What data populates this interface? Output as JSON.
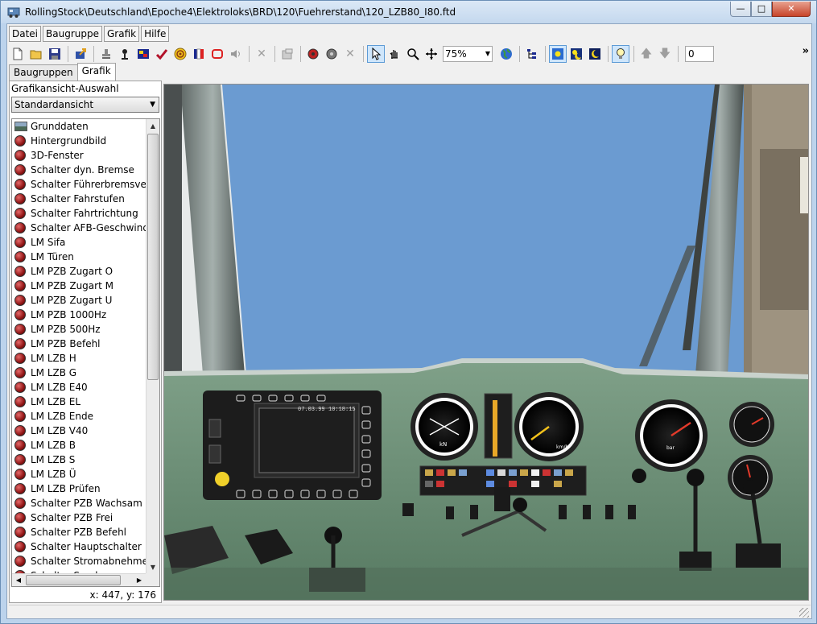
{
  "window": {
    "title": "RollingStock\\Deutschland\\Epoche4\\Elektroloks\\BRD\\120\\Fuehrerstand\\120_LZB80_I80.ftd",
    "controls": [
      "minimize",
      "maximize",
      "close"
    ]
  },
  "menu": [
    {
      "label": "Datei",
      "accel": "D"
    },
    {
      "label": "Baugruppe",
      "accel": "B"
    },
    {
      "label": "Grafik",
      "accel": "G"
    },
    {
      "label": "Hilfe",
      "accel": "H"
    }
  ],
  "toolbar": {
    "zoom": "75%",
    "number_value": "0",
    "overflow": "»",
    "icons": [
      "new-file-icon",
      "open-folder-icon",
      "save-icon",
      "export-icon",
      "stamp-icon",
      "pin-icon",
      "color-icon",
      "check-icon",
      "spiral-icon",
      "flag-icon",
      "frame-icon",
      "speaker-icon",
      "delete-icon",
      "properties-icon",
      "gauge-red-icon",
      "gauge-grey-icon",
      "cross-icon",
      "pointer-icon",
      "hand-icon",
      "magnifier-icon",
      "move-icon",
      "globe-icon",
      "tree-icon",
      "sun-icon",
      "sun-moon-icon",
      "moon-icon",
      "lightbulb-icon",
      "arrow-up-icon",
      "arrow-down-icon"
    ]
  },
  "tabs": [
    {
      "label": "Baugruppen",
      "active": false
    },
    {
      "label": "Grafik",
      "active": true
    }
  ],
  "left_panel": {
    "label": "Grafikansicht-Auswahl",
    "selected_view": "Standardansicht",
    "items": [
      {
        "label": "Grunddaten",
        "icon": "photo"
      },
      {
        "label": "Hintergrundbild",
        "icon": "gauge"
      },
      {
        "label": "3D-Fenster",
        "icon": "gauge"
      },
      {
        "label": "Schalter dyn. Bremse",
        "icon": "gauge"
      },
      {
        "label": "Schalter Führerbremsventil",
        "icon": "gauge"
      },
      {
        "label": "Schalter Fahrstufen",
        "icon": "gauge"
      },
      {
        "label": "Schalter Fahrtrichtung",
        "icon": "gauge"
      },
      {
        "label": "Schalter AFB-Geschwindig",
        "icon": "gauge"
      },
      {
        "label": "LM Sifa",
        "icon": "gauge"
      },
      {
        "label": "LM Türen",
        "icon": "gauge"
      },
      {
        "label": "LM PZB Zugart O",
        "icon": "gauge"
      },
      {
        "label": "LM PZB Zugart M",
        "icon": "gauge"
      },
      {
        "label": "LM PZB Zugart U",
        "icon": "gauge"
      },
      {
        "label": "LM PZB 1000Hz",
        "icon": "gauge"
      },
      {
        "label": "LM PZB 500Hz",
        "icon": "gauge"
      },
      {
        "label": "LM PZB Befehl",
        "icon": "gauge"
      },
      {
        "label": "LM LZB H",
        "icon": "gauge"
      },
      {
        "label": "LM LZB G",
        "icon": "gauge"
      },
      {
        "label": "LM LZB E40",
        "icon": "gauge"
      },
      {
        "label": "LM LZB EL",
        "icon": "gauge"
      },
      {
        "label": "LM LZB Ende",
        "icon": "gauge"
      },
      {
        "label": "LM LZB V40",
        "icon": "gauge"
      },
      {
        "label": "LM LZB B",
        "icon": "gauge"
      },
      {
        "label": "LM LZB S",
        "icon": "gauge"
      },
      {
        "label": "LM LZB Ü",
        "icon": "gauge"
      },
      {
        "label": "LM LZB Prüfen",
        "icon": "gauge"
      },
      {
        "label": "Schalter PZB Wachsam",
        "icon": "gauge"
      },
      {
        "label": "Schalter PZB Frei",
        "icon": "gauge"
      },
      {
        "label": "Schalter PZB Befehl",
        "icon": "gauge"
      },
      {
        "label": "Schalter Hauptschalter",
        "icon": "gauge"
      },
      {
        "label": "Schalter Stromabnehmer",
        "icon": "gauge"
      },
      {
        "label": "Schalter Sanden",
        "icon": "gauge"
      }
    ],
    "coordinates": "x: 447,  y: 176"
  },
  "cab": {
    "display_date": "07.03.99",
    "display_time": "10:18:15",
    "gauge_units": {
      "left": "kN",
      "middle": "km/h",
      "right": "bar"
    },
    "colors": {
      "sky": "#6b9bd1",
      "desk": "#6f9478",
      "frame": "#7d8a86"
    }
  }
}
